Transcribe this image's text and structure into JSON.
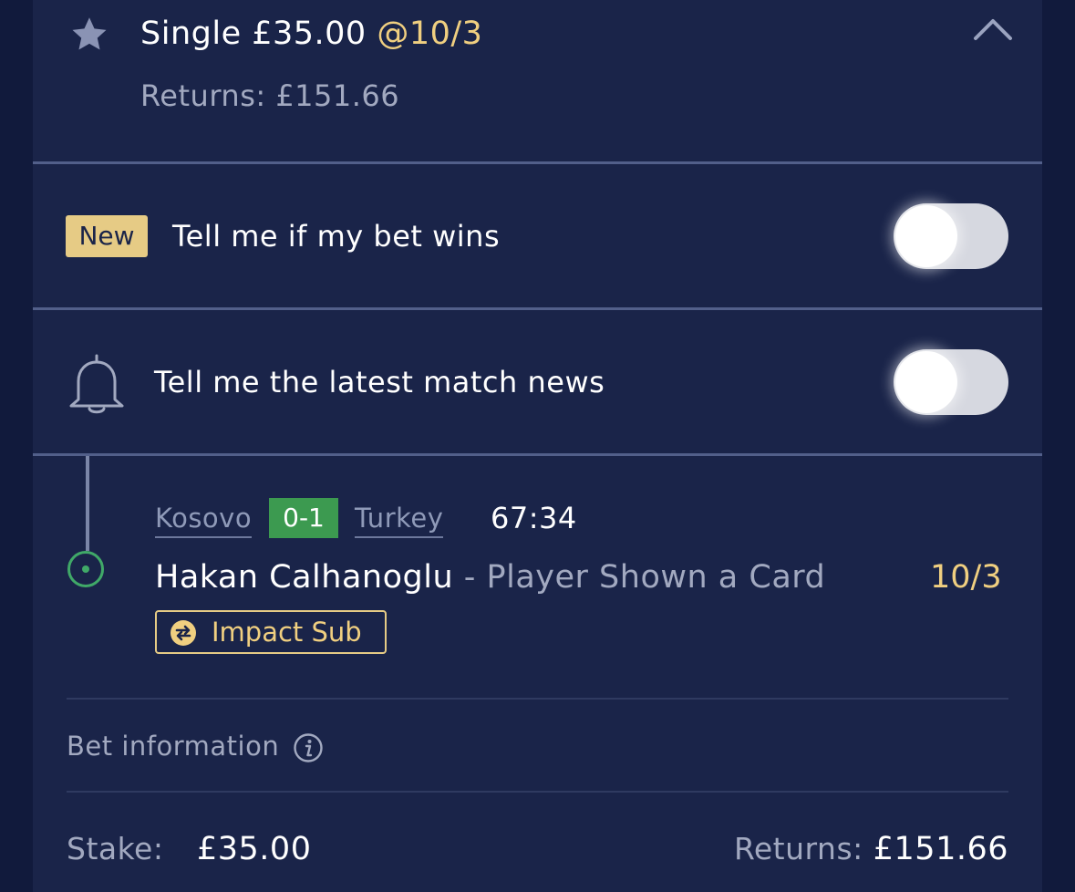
{
  "colors": {
    "background": "#111a3c",
    "card": "#1a2449",
    "accent_gold": "#f0cf80",
    "badge_gold": "#e6cb85",
    "score_green": "#3c9a50",
    "muted_text": "#a2a9c0"
  },
  "bet_header": {
    "star_icon": "star-icon",
    "title": "Single £35.00",
    "odds": "@10/3",
    "returns": "Returns: £151.66",
    "collapse_icon": "chevron-up-icon"
  },
  "notify_win": {
    "badge": "New",
    "label": "Tell me if my bet wins",
    "enabled": false
  },
  "notify_news": {
    "icon": "bell-icon",
    "label": "Tell me the latest match news",
    "enabled": false
  },
  "selection": {
    "home_team": "Kosovo",
    "score": "0-1",
    "away_team": "Turkey",
    "match_time": "67:34",
    "player": "Hakan Calhanoglu",
    "market": " - Player Shown a Card",
    "odds": "10/3",
    "impact_sub_label": "Impact Sub"
  },
  "bet_info": {
    "label": "Bet information"
  },
  "footer": {
    "stake_label": "Stake:",
    "stake_value": "£35.00",
    "returns_label": "Returns:",
    "returns_value": "£151.66"
  }
}
